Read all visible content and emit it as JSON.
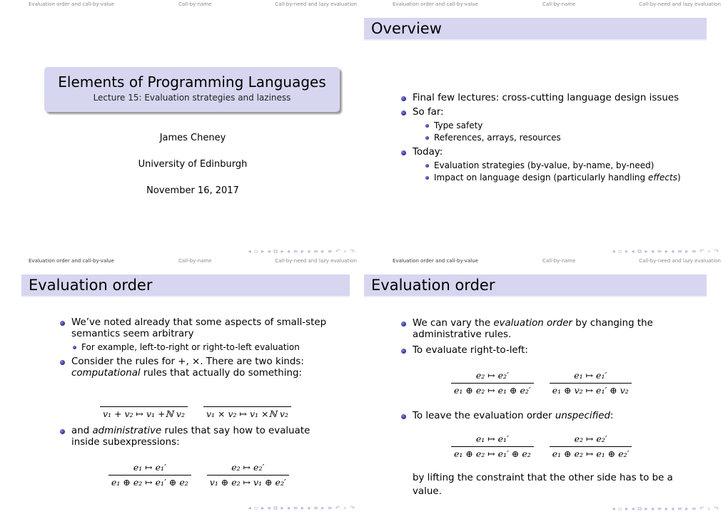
{
  "nav_sections": [
    "Evaluation order and call-by-value",
    "Call-by-name",
    "Call-by-need and lazy evaluation"
  ],
  "nav_symbols": "◂ ▫ ▸ ◂ ⧉ ▸ ◂ ≡ ▸ ◂ ≡ ▸   ≡   ↶ ⌕ ↷",
  "slide1": {
    "title": "Elements of Programming Languages",
    "subtitle": "Lecture 15: Evaluation strategies and laziness",
    "author": "James Cheney",
    "institute": "University of Edinburgh",
    "date": "November 16, 2017"
  },
  "slide2": {
    "frame_title": "Overview",
    "items": [
      {
        "text": "Final few lectures: cross-cutting language design issues"
      },
      {
        "text": "So far:",
        "sub": [
          "Type safety",
          "References, arrays, resources"
        ]
      },
      {
        "text": "Today:",
        "sub": [
          "Evaluation strategies (by-value, by-name, by-need)",
          "Impact on language design (particularly handling ",
          "effects",
          ")"
        ]
      }
    ]
  },
  "slide3": {
    "frame_title": "Evaluation order",
    "b1": "We’ve noted already that some aspects of small-step semantics seem arbitrary",
    "b1_sub": "For example, left-to-right or right-to-left evaluation",
    "b2_pre": "Consider the rules for +, ×. There are two kinds:",
    "b2_it": "computational",
    "b2_post": " rules that actually do something:",
    "comp_rules": [
      {
        "premise": "",
        "conclusion": "v₁ + v₂ ↦ v₁ +ℕ v₂"
      },
      {
        "premise": "",
        "conclusion": "v₁ × v₂ ↦ v₁ ×ℕ v₂"
      }
    ],
    "b3_pre": "and ",
    "b3_it": "administrative",
    "b3_post": " rules that say how to evaluate inside subexpressions:",
    "admin_rules": [
      {
        "premise": "e₁ ↦ e₁′",
        "conclusion": "e₁ ⊕ e₂ ↦ e₁′ ⊕ e₂"
      },
      {
        "premise": "e₂ ↦ e₂′",
        "conclusion": "v₁ ⊕ e₂ ↦ v₁ ⊕ e₂′"
      }
    ]
  },
  "slide4": {
    "frame_title": "Evaluation order",
    "b1_pre": "We can vary the ",
    "b1_it": "evaluation order",
    "b1_post": " by changing the administrative rules.",
    "b2": "To evaluate right-to-left:",
    "rtl_rules": [
      {
        "premise": "e₂ ↦ e₂′",
        "conclusion": "e₁ ⊕ e₂ ↦ e₁ ⊕ e₂′"
      },
      {
        "premise": "e₁ ↦ e₁′",
        "conclusion": "e₁ ⊕ v₂ ↦ e₁′ ⊕ v₂"
      }
    ],
    "b3_pre": "To leave the evaluation order ",
    "b3_it": "unspecified",
    "b3_post": ":",
    "unspec_rules": [
      {
        "premise": "e₁ ↦ e₁′",
        "conclusion": "e₁ ⊕ e₂ ↦ e₁′ ⊕ e₂"
      },
      {
        "premise": "e₂ ↦ e₂′",
        "conclusion": "e₁ ⊕ e₂ ↦ e₁ ⊕ e₂′"
      }
    ],
    "closing": "by lifting the constraint that the other side has to be a value."
  }
}
